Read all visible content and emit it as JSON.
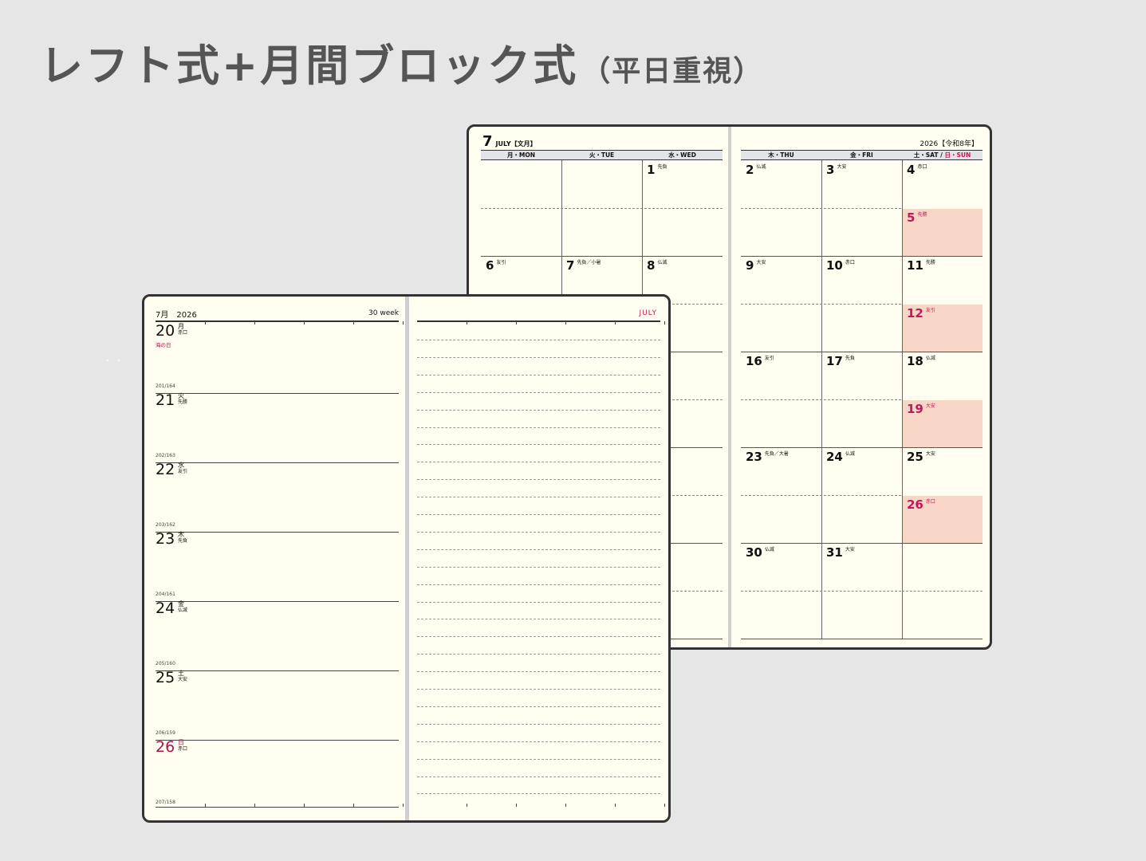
{
  "title": {
    "main": "レフト式+月間ブロック式",
    "sub": "（平日重視）"
  },
  "monthly": {
    "month_num": "7",
    "month_label": "JULY【文月】",
    "year_label": "2026【令和8年】",
    "weekdays": [
      "月・MON",
      "火・TUE",
      "水・WED",
      "木・THU",
      "金・FRI",
      "土・SAT"
    ],
    "sunday_label": "日・SUN",
    "weeks": [
      [
        null,
        null,
        {
          "d": "1",
          "r": "先負"
        },
        {
          "d": "2",
          "r": "仏滅"
        },
        {
          "d": "3",
          "r": "大安"
        },
        {
          "d": "4",
          "r": "赤口"
        },
        {
          "d": "5",
          "r": "先勝"
        }
      ],
      [
        {
          "d": "6",
          "r": "友引"
        },
        {
          "d": "7",
          "r": "先負／小暑"
        },
        {
          "d": "8",
          "r": "仏滅"
        },
        {
          "d": "9",
          "r": "大安"
        },
        {
          "d": "10",
          "r": "赤口"
        },
        {
          "d": "11",
          "r": "先勝"
        },
        {
          "d": "12",
          "r": "友引"
        }
      ],
      [
        null,
        null,
        null,
        {
          "d": "16",
          "r": "友引"
        },
        {
          "d": "17",
          "r": "先負"
        },
        {
          "d": "18",
          "r": "仏滅"
        },
        {
          "d": "19",
          "r": "大安"
        }
      ],
      [
        null,
        null,
        null,
        {
          "d": "23",
          "r": "先負／大暑"
        },
        {
          "d": "24",
          "r": "仏滅"
        },
        {
          "d": "25",
          "r": "大安"
        },
        {
          "d": "26",
          "r": "赤口"
        }
      ],
      [
        null,
        null,
        null,
        {
          "d": "30",
          "r": "仏滅"
        },
        {
          "d": "31",
          "r": "大安"
        },
        null,
        null
      ]
    ]
  },
  "weekly": {
    "month_label": "7月",
    "year": "2026",
    "week_label": "30 week",
    "month_en": "JULY",
    "days": [
      {
        "d": "20",
        "wd": "月",
        "rk": "赤口",
        "holiday": "海の日",
        "count": "201/164",
        "sunday": false
      },
      {
        "d": "21",
        "wd": "火",
        "rk": "先勝",
        "count": "202/163",
        "sunday": false
      },
      {
        "d": "22",
        "wd": "水",
        "rk": "友引",
        "count": "203/162",
        "sunday": false
      },
      {
        "d": "23",
        "wd": "木",
        "rk": "先負",
        "count": "204/161",
        "sunday": false
      },
      {
        "d": "24",
        "wd": "金",
        "rk": "仏滅",
        "count": "205/160",
        "sunday": false
      },
      {
        "d": "25",
        "wd": "土",
        "rk": "大安",
        "count": "206/159",
        "sunday": false
      },
      {
        "d": "26",
        "wd": "日",
        "rk": "赤口",
        "count": "207/158",
        "sunday": true
      }
    ]
  }
}
